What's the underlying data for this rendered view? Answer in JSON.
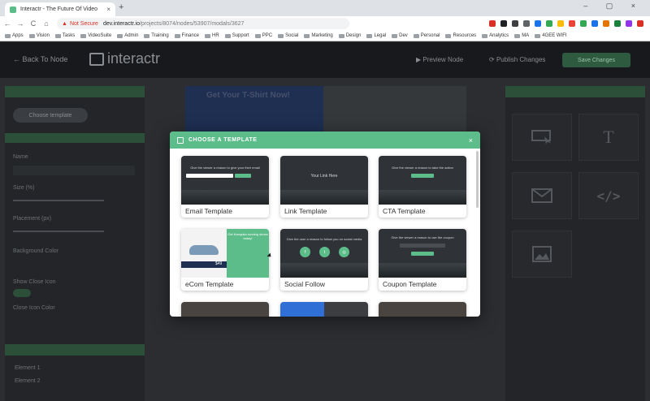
{
  "browser": {
    "tab_title": "Interactr - The Future Of Video",
    "tab_close": "×",
    "new_tab": "+",
    "window_controls": "– ▢ ×",
    "nav": {
      "back": "←",
      "forward": "→",
      "reload": "C",
      "home": "⌂"
    },
    "security_label": "Not Secure",
    "url_host": "dev.interactr.io",
    "url_path": "/projects/8074/nodes/53907/modals/3627",
    "extension_colors": [
      "#d93025",
      "#202124",
      "#3c4043",
      "#5f6368",
      "#1a73e8",
      "#34a853",
      "#fbbc04",
      "#ea4335",
      "#34a853",
      "#1a73e8",
      "#e37400",
      "#188038",
      "#9334e6",
      "#d93025"
    ],
    "bookmarks": [
      "Apps",
      "Vision",
      "Tasks",
      "VideoSuite",
      "Admin",
      "Training",
      "Finance",
      "HR",
      "Support",
      "PPC",
      "Social",
      "Marketing",
      "Design",
      "Legal",
      "Dev",
      "Personal",
      "Resources",
      "Analytics",
      "MA",
      "4GEE WIFI"
    ]
  },
  "app": {
    "back_label": "Back To Node",
    "logo_text": "interactr",
    "preview_label": "Preview Node",
    "publish_label": "Publish Changes",
    "top_button_label": "Save Changes"
  },
  "left_panel": {
    "choose_button": "Choose template",
    "name_label": "Name",
    "size_label": "Size (%)",
    "position_label": "Placement (px)",
    "background_label": "Background Color",
    "show_close_label": "Show Close Icon",
    "close_color_label": "Close Icon Color",
    "elements": [
      "Element 1",
      "Element 2"
    ]
  },
  "canvas": {
    "headline": "Get Your T-Shirt Now!"
  },
  "right_panel": {
    "tiles": [
      "click",
      "text",
      "email",
      "code",
      "image"
    ]
  },
  "modal": {
    "title": "CHOOSE A TEMPLATE",
    "close": "×",
    "accent": "#5dbd8a",
    "templates": [
      {
        "label": "Email Template",
        "thumb_text": "Give the viewer a reason to give your their email"
      },
      {
        "label": "Link Template",
        "thumb_text": "Your Link Here"
      },
      {
        "label": "CTA Template",
        "thumb_text": "Give the viewer a reason to take the action"
      },
      {
        "label": "eCom Template",
        "thumb_text": "Get Kampala running shoes today!"
      },
      {
        "label": "Social Follow",
        "thumb_text": "Give the user a reason to follow you on social media"
      },
      {
        "label": "Coupon Template",
        "thumb_text": "Give the viewer a reason to use the coupon"
      }
    ],
    "ecom_price": "$49"
  }
}
